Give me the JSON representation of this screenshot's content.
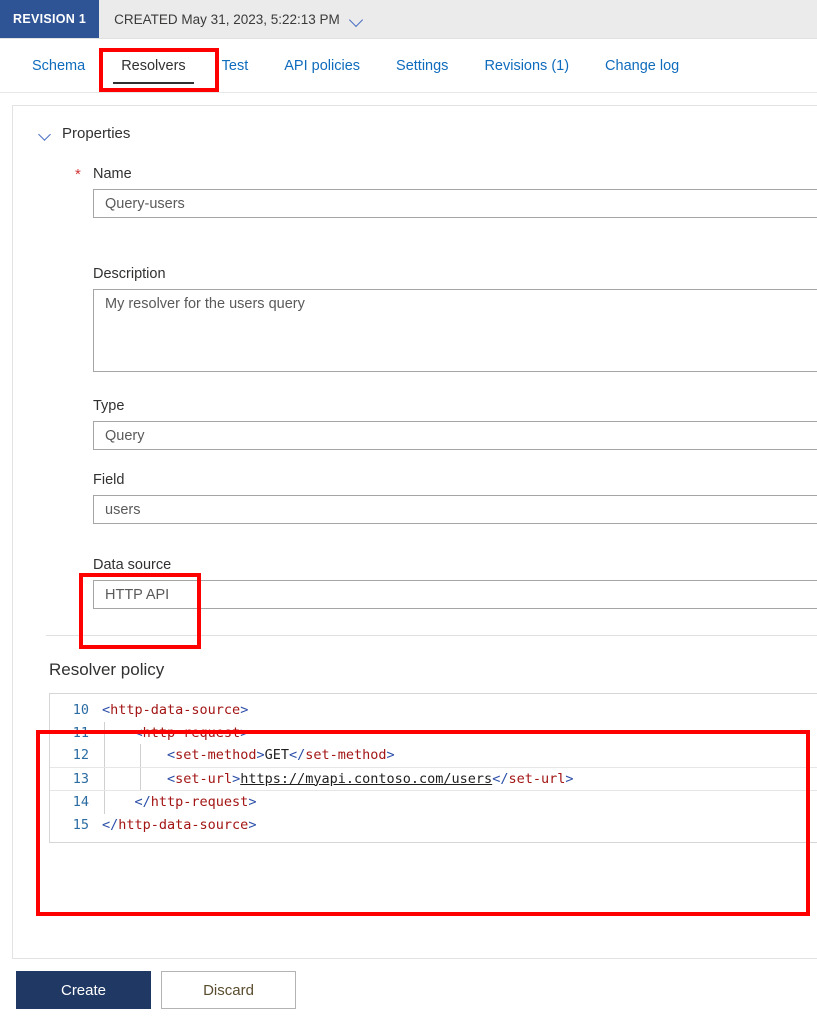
{
  "header": {
    "revision_badge": "REVISION 1",
    "created_text": "CREATED May 31, 2023, 5:22:13 PM",
    "dropdown_icon": "chevron-down-icon"
  },
  "tabs": [
    {
      "label": "Schema",
      "active": false
    },
    {
      "label": "Resolvers",
      "active": true
    },
    {
      "label": "Test",
      "active": false
    },
    {
      "label": "API policies",
      "active": false
    },
    {
      "label": "Settings",
      "active": false
    },
    {
      "label": "Revisions (1)",
      "active": false
    },
    {
      "label": "Change log",
      "active": false
    }
  ],
  "properties": {
    "section_title": "Properties",
    "name_label": "Name",
    "name_required": "*",
    "name_value": "Query-users",
    "description_label": "Description",
    "description_value": "My resolver for the users query",
    "type_label": "Type",
    "type_value": "Query",
    "field_label": "Field",
    "field_value": "users",
    "datasource_label": "Data source",
    "datasource_value": "HTTP API"
  },
  "policy": {
    "title": "Resolver policy",
    "lines": [
      {
        "num": "10",
        "active": false,
        "indent": 0,
        "parts": [
          {
            "t": "br",
            "v": "<"
          },
          {
            "t": "tag",
            "v": "http-data-source"
          },
          {
            "t": "br",
            "v": ">"
          }
        ]
      },
      {
        "num": "11",
        "active": false,
        "indent": 1,
        "parts": [
          {
            "t": "br",
            "v": "<"
          },
          {
            "t": "tag",
            "v": "http-request"
          },
          {
            "t": "br",
            "v": ">"
          }
        ]
      },
      {
        "num": "12",
        "active": false,
        "indent": 2,
        "parts": [
          {
            "t": "br",
            "v": "<"
          },
          {
            "t": "tag",
            "v": "set-method"
          },
          {
            "t": "br",
            "v": ">"
          },
          {
            "t": "txt",
            "v": "GET"
          },
          {
            "t": "br",
            "v": "</"
          },
          {
            "t": "tag",
            "v": "set-method"
          },
          {
            "t": "br",
            "v": ">"
          }
        ]
      },
      {
        "num": "13",
        "active": true,
        "indent": 2,
        "parts": [
          {
            "t": "br",
            "v": "<"
          },
          {
            "t": "tag",
            "v": "set-url"
          },
          {
            "t": "br",
            "v": ">"
          },
          {
            "t": "url",
            "v": "https://myapi.contoso.com/users"
          },
          {
            "t": "br",
            "v": "</"
          },
          {
            "t": "tag",
            "v": "set-url"
          },
          {
            "t": "br",
            "v": ">"
          }
        ]
      },
      {
        "num": "14",
        "active": false,
        "indent": 1,
        "parts": [
          {
            "t": "br",
            "v": "</"
          },
          {
            "t": "tag",
            "v": "http-request"
          },
          {
            "t": "br",
            "v": ">"
          }
        ]
      },
      {
        "num": "15",
        "active": false,
        "indent": 0,
        "parts": [
          {
            "t": "br",
            "v": "</"
          },
          {
            "t": "tag",
            "v": "http-data-source"
          },
          {
            "t": "br",
            "v": ">"
          }
        ]
      }
    ]
  },
  "footer": {
    "create_label": "Create",
    "discard_label": "Discard"
  },
  "annotations": {
    "color": "#ff0000",
    "boxes": [
      "resolvers-tab",
      "data-source-field",
      "resolver-policy-section"
    ]
  },
  "colors": {
    "revision_badge_bg": "#2f5496",
    "tab_link": "#0f6cbd",
    "primary_button_bg": "#1f3864",
    "required_star": "#d13438",
    "xml_tag": "#a31515",
    "xml_bracket": "#2b4ea8",
    "line_number": "#2b6ca3"
  }
}
